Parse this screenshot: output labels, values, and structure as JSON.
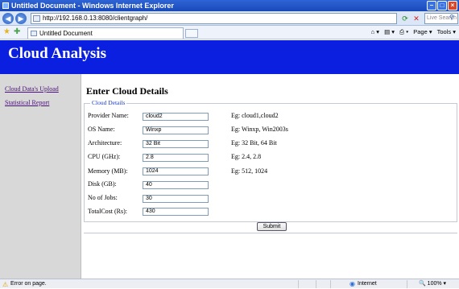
{
  "window": {
    "title": "Untitled Document - Windows Internet Explorer"
  },
  "address_bar": {
    "url": "http://192.168.0.13:8080/clientgraph/",
    "search_placeholder": "Live Search"
  },
  "tab": {
    "label": "Untitled Document"
  },
  "toolbar": {
    "page_label": "Page",
    "tools_label": "Tools"
  },
  "header": {
    "title": "Cloud Analysis"
  },
  "sidebar": {
    "items": [
      {
        "label": "Cloud Data's Upload"
      },
      {
        "label": "Statistical Report"
      }
    ]
  },
  "form": {
    "title": "Enter Cloud Details",
    "legend": "Cloud Details",
    "fields": [
      {
        "label": "Provider Name:",
        "value": "cloud2",
        "example": "Eg: cloud1,cloud2"
      },
      {
        "label": "OS Name:",
        "value": "Winxp",
        "example": "Eg: Winxp, Win2003s"
      },
      {
        "label": "Architecture:",
        "value": "32 Bit",
        "example": "Eg: 32 Bit, 64 Bit"
      },
      {
        "label": "CPU (GHz):",
        "value": "2.8",
        "example": "Eg: 2.4, 2.8"
      },
      {
        "label": "Memory (MB):",
        "value": "1024",
        "example": "Eg: 512, 1024"
      },
      {
        "label": "Disk (GB):",
        "value": "40",
        "example": ""
      },
      {
        "label": "No of Jobs:",
        "value": "30",
        "example": ""
      },
      {
        "label": "TotalCost (Rs):",
        "value": "430",
        "example": ""
      }
    ],
    "submit_label": "Submit"
  },
  "status_bar": {
    "message": "Error on page.",
    "zone": "Internet",
    "zoom": "100%"
  }
}
